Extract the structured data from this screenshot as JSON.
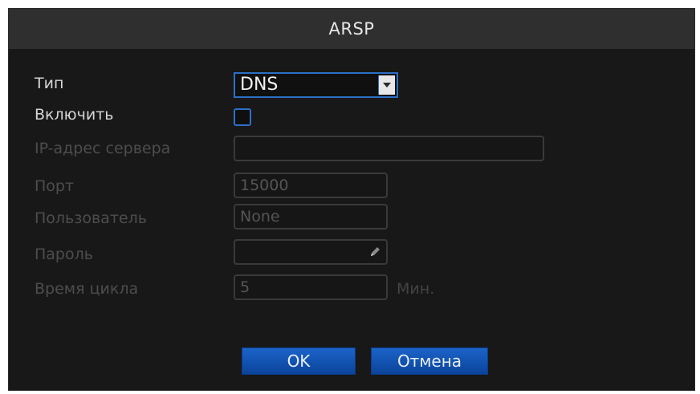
{
  "dialog": {
    "title": "ARSP"
  },
  "form": {
    "type": {
      "label": "Тип",
      "value": "DNS"
    },
    "enable": {
      "label": "Включить",
      "checked": false
    },
    "server_ip": {
      "label": "IP-адрес сервера",
      "value": ""
    },
    "port": {
      "label": "Порт",
      "value": "15000"
    },
    "user": {
      "label": "Пользователь",
      "value": "None"
    },
    "password": {
      "label": "Пароль",
      "value": ""
    },
    "cycle_time": {
      "label": "Время цикла",
      "value": "5",
      "unit": "Мин."
    }
  },
  "buttons": {
    "ok": "OK",
    "cancel": "Отмена"
  },
  "colors": {
    "accent": "#2d6fc6",
    "button": "#1558b8",
    "background": "#181818"
  }
}
